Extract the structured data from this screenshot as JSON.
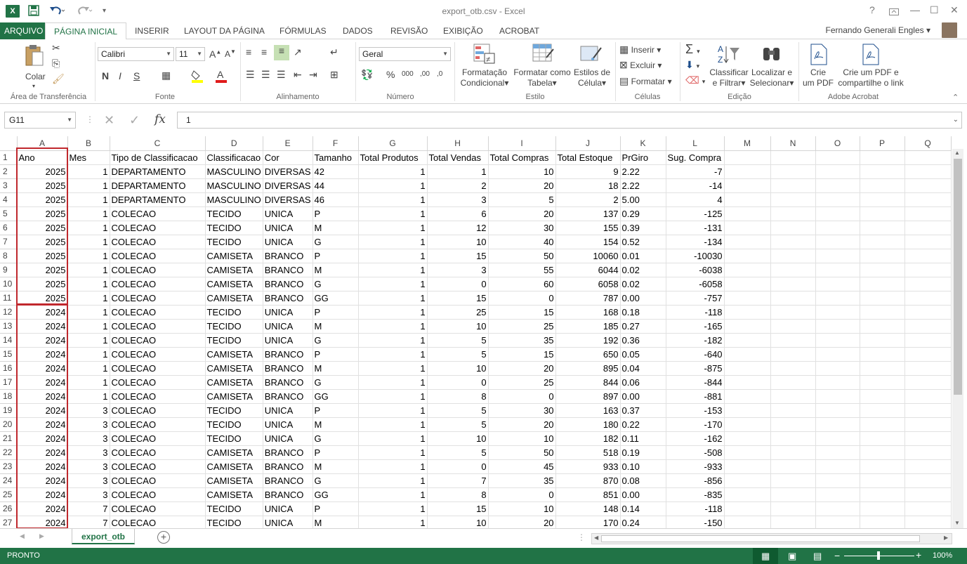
{
  "window": {
    "title": "export_otb.csv - Excel",
    "help": "?",
    "min": "—",
    "max": "☐",
    "close": "✕"
  },
  "quick_access": {
    "save": "💾",
    "undo": "↶",
    "redo": "↷"
  },
  "tabs": [
    {
      "label": "ARQUIVO"
    },
    {
      "label": "PÁGINA INICIAL"
    },
    {
      "label": "INSERIR"
    },
    {
      "label": "LAYOUT DA PÁGINA"
    },
    {
      "label": "FÓRMULAS"
    },
    {
      "label": "DADOS"
    },
    {
      "label": "REVISÃO"
    },
    {
      "label": "EXIBIÇÃO"
    },
    {
      "label": "ACROBAT"
    }
  ],
  "user": {
    "name": "Fernando Generali Engles"
  },
  "ribbon": {
    "clipboard": {
      "paste": "Colar",
      "group": "Área de Transferência"
    },
    "font": {
      "name": "Calibri",
      "size": "11",
      "bold": "N",
      "italic": "I",
      "underline": "S",
      "group": "Fonte"
    },
    "alignment": {
      "group": "Alinhamento"
    },
    "number": {
      "format": "Geral",
      "group": "Número"
    },
    "styles": {
      "cond_format_1": "Formatação",
      "cond_format_2": "Condicional",
      "table_format_1": "Formatar como",
      "table_format_2": "Tabela",
      "cell_styles_1": "Estilos de",
      "cell_styles_2": "Célula",
      "group": "Estilo"
    },
    "cells": {
      "insert": "Inserir",
      "delete": "Excluir",
      "format": "Formatar",
      "group": "Células"
    },
    "editing": {
      "sort_1": "Classificar",
      "sort_2": "e Filtrar",
      "find_1": "Localizar e",
      "find_2": "Selecionar",
      "group": "Edição"
    },
    "acrobat": {
      "create_1": "Crie",
      "create_2": "um PDF",
      "share_1": "Crie um PDF e",
      "share_2": "compartilhe o link",
      "group": "Adobe Acrobat"
    }
  },
  "formula_bar": {
    "name_box": "G11",
    "fx": "fx",
    "value": "1"
  },
  "columns": [
    "A",
    "B",
    "C",
    "D",
    "E",
    "F",
    "G",
    "H",
    "I",
    "J",
    "K",
    "L",
    "M",
    "N",
    "O",
    "P",
    "Q"
  ],
  "header_row": [
    "Ano",
    "Mes",
    "Tipo de Classificacao",
    "Classificacao",
    "Cor",
    "Tamanho",
    "Total Produtos",
    "Total Vendas",
    "Total Compras",
    "Total Estoque",
    "PrGiro",
    "Sug. Compra"
  ],
  "rows": [
    [
      "2025",
      "1",
      "DEPARTAMENTO",
      "MASCULINO",
      "DIVERSAS",
      "42",
      "1",
      "1",
      "10",
      "9",
      "2.22",
      "-7"
    ],
    [
      "2025",
      "1",
      "DEPARTAMENTO",
      "MASCULINO",
      "DIVERSAS",
      "44",
      "1",
      "2",
      "20",
      "18",
      "2.22",
      "-14"
    ],
    [
      "2025",
      "1",
      "DEPARTAMENTO",
      "MASCULINO",
      "DIVERSAS",
      "46",
      "1",
      "3",
      "5",
      "2",
      "5.00",
      "4"
    ],
    [
      "2025",
      "1",
      "COLECAO",
      "TECIDO",
      "UNICA",
      "P",
      "1",
      "6",
      "20",
      "137",
      "0.29",
      "-125"
    ],
    [
      "2025",
      "1",
      "COLECAO",
      "TECIDO",
      "UNICA",
      "M",
      "1",
      "12",
      "30",
      "155",
      "0.39",
      "-131"
    ],
    [
      "2025",
      "1",
      "COLECAO",
      "TECIDO",
      "UNICA",
      "G",
      "1",
      "10",
      "40",
      "154",
      "0.52",
      "-134"
    ],
    [
      "2025",
      "1",
      "COLECAO",
      "CAMISETA",
      "BRANCO",
      "P",
      "1",
      "15",
      "50",
      "10060",
      "0.01",
      "-10030"
    ],
    [
      "2025",
      "1",
      "COLECAO",
      "CAMISETA",
      "BRANCO",
      "M",
      "1",
      "3",
      "55",
      "6044",
      "0.02",
      "-6038"
    ],
    [
      "2025",
      "1",
      "COLECAO",
      "CAMISETA",
      "BRANCO",
      "G",
      "1",
      "0",
      "60",
      "6058",
      "0.02",
      "-6058"
    ],
    [
      "2025",
      "1",
      "COLECAO",
      "CAMISETA",
      "BRANCO",
      "GG",
      "1",
      "15",
      "0",
      "787",
      "0.00",
      "-757"
    ],
    [
      "2024",
      "1",
      "COLECAO",
      "TECIDO",
      "UNICA",
      "P",
      "1",
      "25",
      "15",
      "168",
      "0.18",
      "-118"
    ],
    [
      "2024",
      "1",
      "COLECAO",
      "TECIDO",
      "UNICA",
      "M",
      "1",
      "10",
      "25",
      "185",
      "0.27",
      "-165"
    ],
    [
      "2024",
      "1",
      "COLECAO",
      "TECIDO",
      "UNICA",
      "G",
      "1",
      "5",
      "35",
      "192",
      "0.36",
      "-182"
    ],
    [
      "2024",
      "1",
      "COLECAO",
      "CAMISETA",
      "BRANCO",
      "P",
      "1",
      "5",
      "15",
      "650",
      "0.05",
      "-640"
    ],
    [
      "2024",
      "1",
      "COLECAO",
      "CAMISETA",
      "BRANCO",
      "M",
      "1",
      "10",
      "20",
      "895",
      "0.04",
      "-875"
    ],
    [
      "2024",
      "1",
      "COLECAO",
      "CAMISETA",
      "BRANCO",
      "G",
      "1",
      "0",
      "25",
      "844",
      "0.06",
      "-844"
    ],
    [
      "2024",
      "1",
      "COLECAO",
      "CAMISETA",
      "BRANCO",
      "GG",
      "1",
      "8",
      "0",
      "897",
      "0.00",
      "-881"
    ],
    [
      "2024",
      "3",
      "COLECAO",
      "TECIDO",
      "UNICA",
      "P",
      "1",
      "5",
      "30",
      "163",
      "0.37",
      "-153"
    ],
    [
      "2024",
      "3",
      "COLECAO",
      "TECIDO",
      "UNICA",
      "M",
      "1",
      "5",
      "20",
      "180",
      "0.22",
      "-170"
    ],
    [
      "2024",
      "3",
      "COLECAO",
      "TECIDO",
      "UNICA",
      "G",
      "1",
      "10",
      "10",
      "182",
      "0.11",
      "-162"
    ],
    [
      "2024",
      "3",
      "COLECAO",
      "CAMISETA",
      "BRANCO",
      "P",
      "1",
      "5",
      "50",
      "518",
      "0.19",
      "-508"
    ],
    [
      "2024",
      "3",
      "COLECAO",
      "CAMISETA",
      "BRANCO",
      "M",
      "1",
      "0",
      "45",
      "933",
      "0.10",
      "-933"
    ],
    [
      "2024",
      "3",
      "COLECAO",
      "CAMISETA",
      "BRANCO",
      "G",
      "1",
      "7",
      "35",
      "870",
      "0.08",
      "-856"
    ],
    [
      "2024",
      "3",
      "COLECAO",
      "CAMISETA",
      "BRANCO",
      "GG",
      "1",
      "8",
      "0",
      "851",
      "0.00",
      "-835"
    ],
    [
      "2024",
      "7",
      "COLECAO",
      "TECIDO",
      "UNICA",
      "P",
      "1",
      "15",
      "10",
      "148",
      "0.14",
      "-118"
    ],
    [
      "2024",
      "7",
      "COLECAO",
      "TECIDO",
      "UNICA",
      "M",
      "1",
      "10",
      "20",
      "170",
      "0.24",
      "-150"
    ]
  ],
  "sheet_tab": "export_otb",
  "status": {
    "mode": "PRONTO",
    "zoom": "100%"
  },
  "colors": {
    "accent": "#217346",
    "highlight": "#c0282d"
  }
}
